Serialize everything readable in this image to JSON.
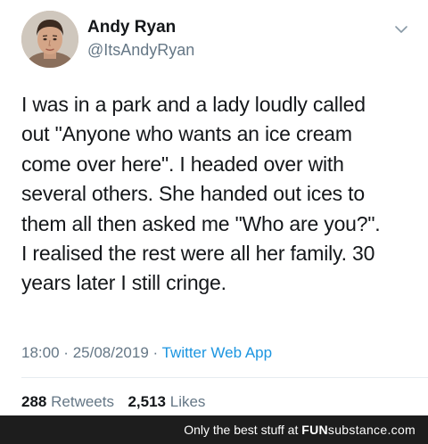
{
  "tweet": {
    "author_name": "Andy Ryan",
    "author_handle": "@ItsAndyRyan",
    "menu_icon": "chevron-down-icon",
    "text_lines": [
      "I was in a park and a lady loudly called",
      "out \"Anyone who wants an ice cream",
      "come over here\". I headed over with",
      "several others. She handed out ices to",
      "them all then asked me \"Who are you?\".",
      "I realised the rest were all her family. 30",
      "years later I still cringe."
    ],
    "time": "18:00",
    "separator": "·",
    "date": "25/08/2019",
    "source": "Twitter Web App",
    "retweets_count": "288",
    "retweets_label": "Retweets",
    "likes_count": "2,513",
    "likes_label": "Likes"
  },
  "footer": {
    "text": "Only the best stuff at",
    "brand_main": "FUN",
    "brand_sub": "substance",
    "brand_suffix": ".com"
  },
  "colors": {
    "text": "#14171a",
    "secondary": "#657786",
    "link": "#1b95e0",
    "divider": "#e6ecf0",
    "footer_bg": "#1d1d1d"
  }
}
